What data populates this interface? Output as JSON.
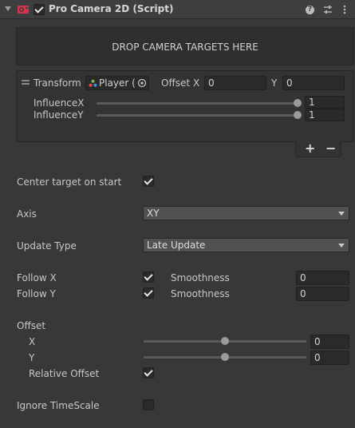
{
  "header": {
    "title": "Pro Camera 2D (Script)",
    "enabled": true,
    "icons": [
      "foldout-arrow-icon",
      "camera-component-icon",
      "help-icon",
      "preset-icon",
      "more-menu-icon"
    ]
  },
  "drop_area": {
    "label": "DROP CAMERA TARGETS HERE"
  },
  "targets": {
    "items": [
      {
        "transform_label": "Transform",
        "transform_value": "Player (",
        "offset_label": "Offset",
        "x_label": "X",
        "x_value": "0",
        "y_label": "Y",
        "y_value": "0",
        "influence_x_label": "InfluenceX",
        "influence_x_value": "1",
        "influence_y_label": "InfluenceY",
        "influence_y_value": "1"
      }
    ],
    "add_label": "+",
    "remove_label": "−"
  },
  "settings": {
    "center_target_label": "Center target on start",
    "center_target_checked": true,
    "axis_label": "Axis",
    "axis_value": "XY",
    "update_type_label": "Update Type",
    "update_type_value": "Late Update",
    "follow_x_label": "Follow X",
    "follow_x_checked": true,
    "follow_x_smooth_label": "Smoothness",
    "follow_x_smooth_value": "0",
    "follow_y_label": "Follow Y",
    "follow_y_checked": true,
    "follow_y_smooth_label": "Smoothness",
    "follow_y_smooth_value": "0",
    "offset_label": "Offset",
    "offset_x_label": "X",
    "offset_x_value": "0",
    "offset_y_label": "Y",
    "offset_y_value": "0",
    "relative_offset_label": "Relative Offset",
    "relative_offset_checked": true,
    "ignore_timescale_label": "Ignore TimeScale",
    "ignore_timescale_checked": false
  },
  "colors": {
    "background": "#383838",
    "field": "#2a2a2a",
    "dropdown": "#515151",
    "text": "#c8c8c8"
  }
}
